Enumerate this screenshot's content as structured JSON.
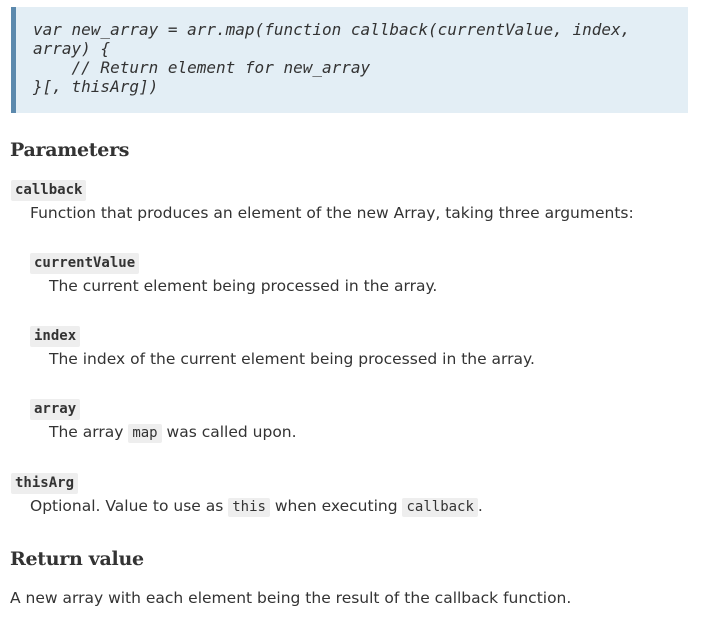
{
  "syntax": {
    "line1": "var new_array = arr.map(function callback(currentValue, index,",
    "line2": "array) {",
    "line3": "    // Return element for new_array",
    "line4": "}[, thisArg])"
  },
  "parameters_heading": "Parameters",
  "callback": {
    "name": "callback",
    "description": "Function that produces an element of the new Array, taking three arguments:"
  },
  "currentValue": {
    "name": "currentValue",
    "description": "The current element being processed in the array."
  },
  "index": {
    "name": "index",
    "description": "The index of the current element being processed in the array."
  },
  "array": {
    "name": "array",
    "desc_pre": "The array ",
    "desc_code": "map",
    "desc_post": " was called upon."
  },
  "thisArg": {
    "name": "thisArg",
    "desc_pre": "Optional. Value to use as ",
    "desc_code1": "this",
    "desc_mid": " when executing ",
    "desc_code2": "callback",
    "desc_post": "."
  },
  "return_heading": "Return value",
  "return_description": "A new array with each element being the result of the callback function."
}
